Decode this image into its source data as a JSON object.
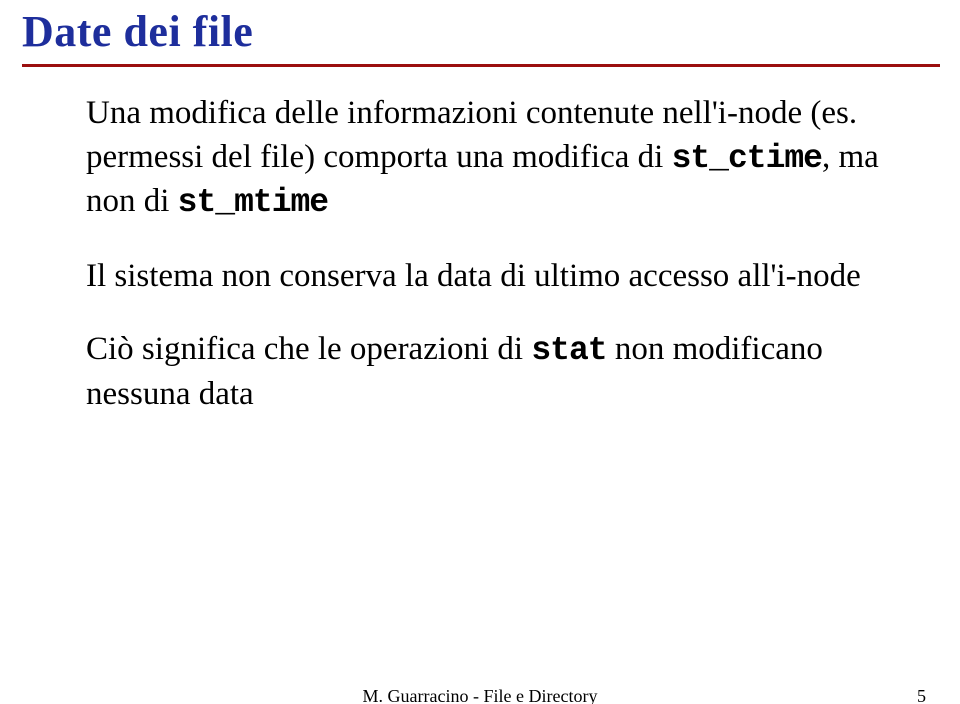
{
  "title": "Date dei file",
  "para1_a": "Una modifica delle informazioni contenute nell'i-node (es. permessi del file) comporta una modifica di ",
  "para1_code1": "st_ctime",
  "para1_b": ", ma non di ",
  "para1_code2": "st_mtime",
  "para2": "Il sistema non conserva la data di ultimo accesso all'i-node",
  "para3_a": "Ciò significa che le operazioni di ",
  "para3_code1": "stat",
  "para3_b": " non modificano nessuna data",
  "footer_center": "M. Guarracino - File e Directory",
  "footer_page": "5"
}
